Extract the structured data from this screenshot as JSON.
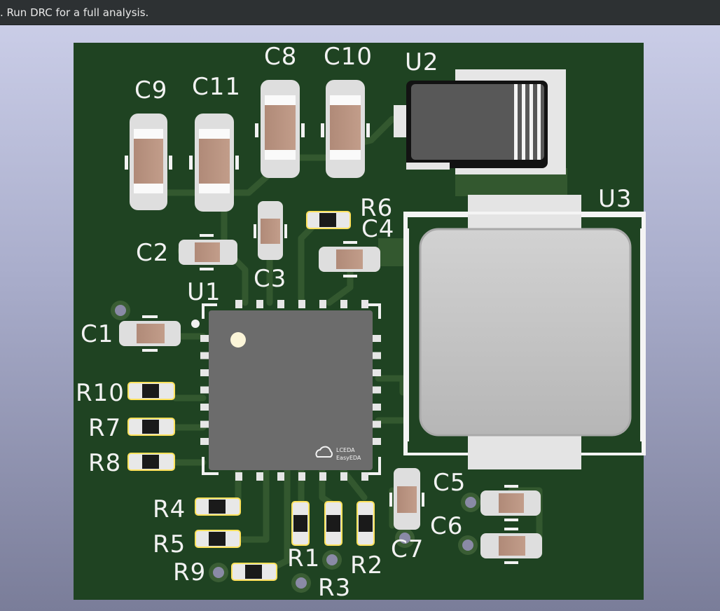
{
  "status_bar": {
    "message": ". Run DRC for a full analysis."
  },
  "board": {
    "colors": {
      "substrate": "#1f4322",
      "copper": "#33582f",
      "pad": "#dcdcdc",
      "pad_highlight": "#ffe25c",
      "ic_body": "#6c6c6c",
      "inductor": "#c3c3c3"
    },
    "refs": {
      "c1": "C1",
      "c2": "C2",
      "c3": "C3",
      "c4": "C4",
      "c5": "C5",
      "c6": "C6",
      "c7": "C7",
      "c8": "C8",
      "c9": "C9",
      "c10": "C10",
      "c11": "C11",
      "r1": "R1",
      "r2": "R2",
      "r3": "R3",
      "r4": "R4",
      "r5": "R5",
      "r6": "R6",
      "r7": "R7",
      "r8": "R8",
      "r9": "R9",
      "r10": "R10",
      "u1": "U1",
      "u2": "U2",
      "u3": "U3"
    },
    "logo": {
      "line1": "LCEDA",
      "line2": "EasyEDA",
      "icon": "cloud-icon"
    }
  }
}
